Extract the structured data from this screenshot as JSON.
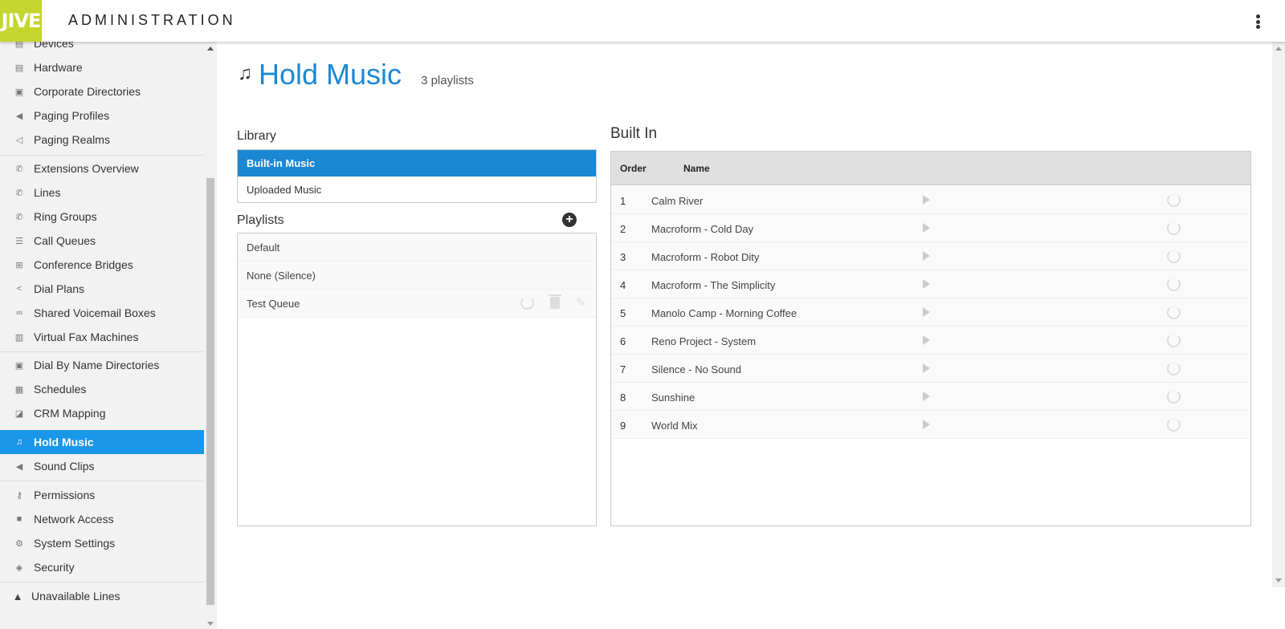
{
  "header": {
    "logo_text": "JIVE",
    "title": "ADMINISTRATION"
  },
  "sidebar": {
    "items": [
      {
        "label": "Devices",
        "icon": "devices-icon"
      },
      {
        "label": "Hardware",
        "icon": "hardware-icon"
      },
      {
        "label": "Corporate Directories",
        "icon": "directory-icon"
      },
      {
        "label": "Paging Profiles",
        "icon": "megaphone-icon"
      },
      {
        "label": "Paging Realms",
        "icon": "paging-realm-icon"
      },
      {
        "label": "Extensions Overview",
        "icon": "phone-icon"
      },
      {
        "label": "Lines",
        "icon": "phone-icon"
      },
      {
        "label": "Ring Groups",
        "icon": "ring-group-icon"
      },
      {
        "label": "Call Queues",
        "icon": "list-icon"
      },
      {
        "label": "Conference Bridges",
        "icon": "conference-icon"
      },
      {
        "label": "Dial Plans",
        "icon": "share-icon"
      },
      {
        "label": "Shared Voicemail Boxes",
        "icon": "voicemail-icon"
      },
      {
        "label": "Virtual Fax Machines",
        "icon": "fax-icon"
      },
      {
        "label": "Dial By Name Directories",
        "icon": "directory-icon"
      },
      {
        "label": "Schedules",
        "icon": "calendar-icon"
      },
      {
        "label": "CRM Mapping",
        "icon": "crm-icon"
      },
      {
        "label": "Hold Music",
        "icon": "music-note-icon"
      },
      {
        "label": "Sound Clips",
        "icon": "speaker-icon"
      },
      {
        "label": "Permissions",
        "icon": "key-icon"
      },
      {
        "label": "Network Access",
        "icon": "lock-icon"
      },
      {
        "label": "System Settings",
        "icon": "gear-icon"
      },
      {
        "label": "Security",
        "icon": "shield-icon"
      },
      {
        "label": "Unavailable Lines",
        "icon": "warning-icon"
      }
    ]
  },
  "page": {
    "title": "Hold Music",
    "subtitle": "3 playlists",
    "title_color": "#1b88d4"
  },
  "library": {
    "label": "Library",
    "items": [
      "Built-in Music",
      "Uploaded Music"
    ],
    "active": "Built-in Music"
  },
  "playlists": {
    "label": "Playlists",
    "items": [
      "Default",
      "None (Silence)",
      "Test Queue"
    ]
  },
  "builtin": {
    "title": "Built In",
    "columns": {
      "order": "Order",
      "name": "Name"
    },
    "rows": [
      {
        "order": "1",
        "name": "Calm River"
      },
      {
        "order": "2",
        "name": "Macroform - Cold Day"
      },
      {
        "order": "3",
        "name": "Macroform - Robot Dity"
      },
      {
        "order": "4",
        "name": "Macroform - The Simplicity"
      },
      {
        "order": "5",
        "name": "Manolo Camp - Morning Coffee"
      },
      {
        "order": "6",
        "name": "Reno Project - System"
      },
      {
        "order": "7",
        "name": "Silence - No Sound"
      },
      {
        "order": "8",
        "name": "Sunshine"
      },
      {
        "order": "9",
        "name": "World Mix"
      }
    ]
  },
  "colors": {
    "accent": "#1b97e9",
    "logo_bg": "#c4d52e"
  }
}
